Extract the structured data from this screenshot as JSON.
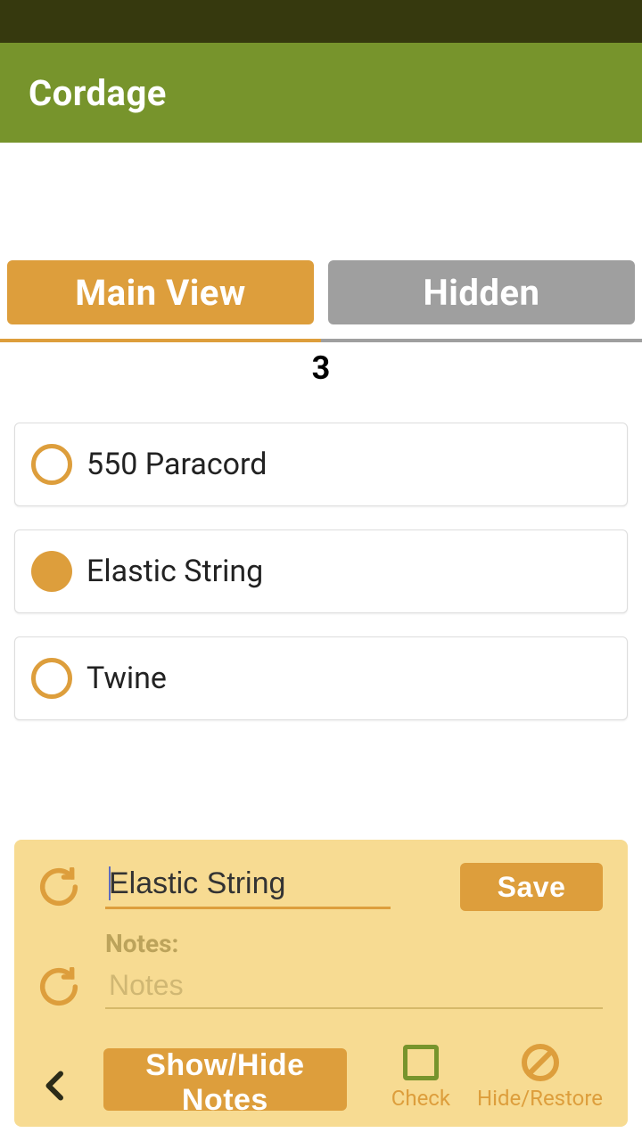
{
  "header": {
    "title": "Cordage"
  },
  "tabs": {
    "main": "Main View",
    "hidden": "Hidden",
    "active": "main"
  },
  "count": "3",
  "items": [
    {
      "label": "550 Paracord",
      "checked": false
    },
    {
      "label": "Elastic String",
      "checked": true
    },
    {
      "label": "Twine",
      "checked": false
    }
  ],
  "panel": {
    "title_value": "Elastic String",
    "save_label": "Save",
    "notes_heading": "Notes:",
    "notes_placeholder": "Notes",
    "notes_value": "",
    "show_hide_label": "Show/Hide Notes",
    "check_label": "Check",
    "hide_restore_label": "Hide/Restore"
  },
  "colors": {
    "accent": "#dd9e3c",
    "header": "#77942c",
    "status": "#36390e",
    "panel": "#f7db92"
  }
}
